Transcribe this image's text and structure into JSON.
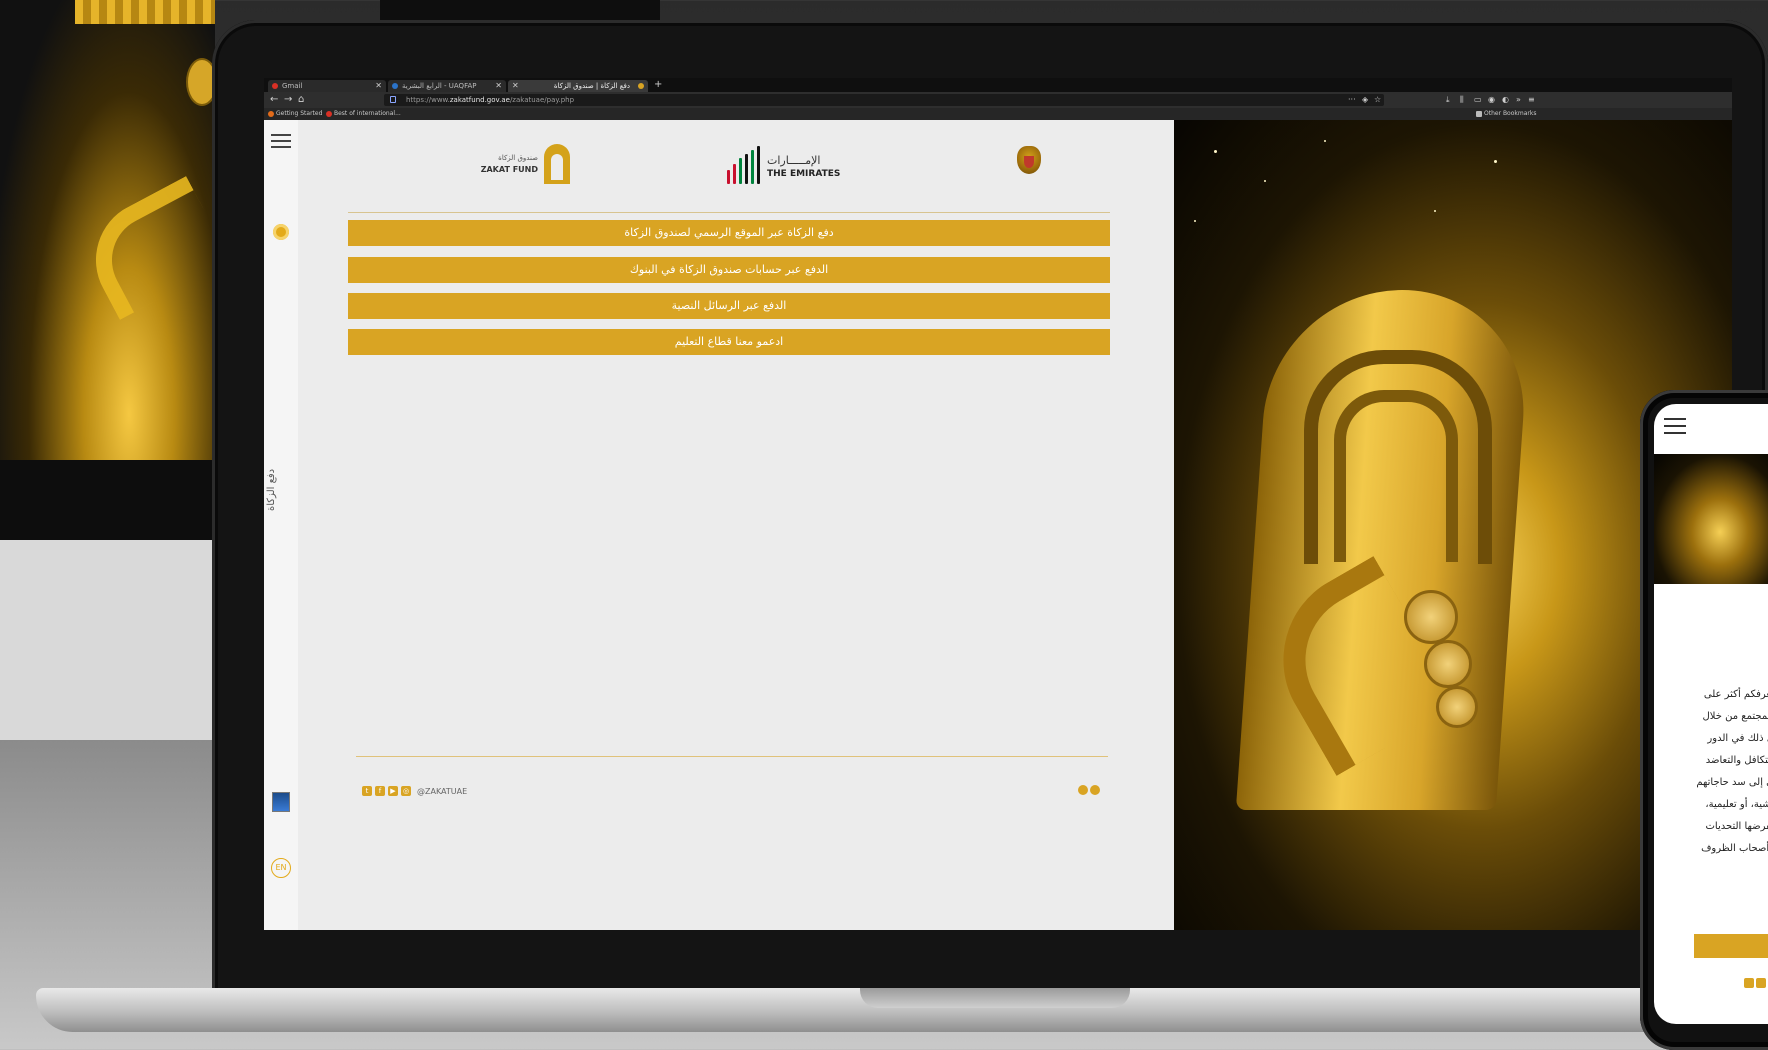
{
  "browser": {
    "tabs": [
      {
        "label": "Gmail",
        "favicon_color": "#d93025",
        "active": false
      },
      {
        "label": "الرابع البشرية - UAQFAP",
        "favicon_color": "#2b73c9",
        "active": false
      },
      {
        "label": "دفع الزكاة | صندوق الزكاة",
        "favicon_color": "#d9a423",
        "active": true
      }
    ],
    "url_prefix": "https://www.",
    "url_domain": "zakatfund.gov.ae",
    "url_path": "/zakatuae/pay.php",
    "bookmarks": [
      {
        "label": "Getting Started",
        "color": "#e26b1a"
      },
      {
        "label": "Best of international...",
        "color": "#d93025"
      }
    ],
    "other_bookmarks": "Other Bookmarks"
  },
  "page": {
    "logos": {
      "zakat_ar": "صندوق الزكاة",
      "zakat_en": "ZAKAT FUND",
      "emirates_ar": "الإمـــــارات",
      "emirates_en": "THE EMIRATES"
    },
    "menu": [
      "دفع الزكاة عبر الموقع الرسمي لصندوق الزكاة",
      "الدفع عبر حسابات صندوق الزكاة في البنوك",
      "الدفع عبر الرسائل النصية",
      "ادعمو معنا قطاع التعليم"
    ],
    "rail": {
      "vertical_label": "دفع الزكاة",
      "lang": "EN"
    },
    "footer": {
      "handle": "@ZAKATUAE"
    },
    "colors": {
      "accent": "#d9a423",
      "page_bg": "#ececec"
    }
  },
  "phone": {
    "text_lines": [
      "نعرفكم أكثر على",
      "للمجتمع من خلال",
      "ل ذلك في الدور",
      "التكافل والتعاضد",
      "ى إلى سد حاجاتهم",
      "يشية، أو تعليمية،",
      "تفرضها التحديات",
      "وأصحاب الظروف"
    ]
  }
}
